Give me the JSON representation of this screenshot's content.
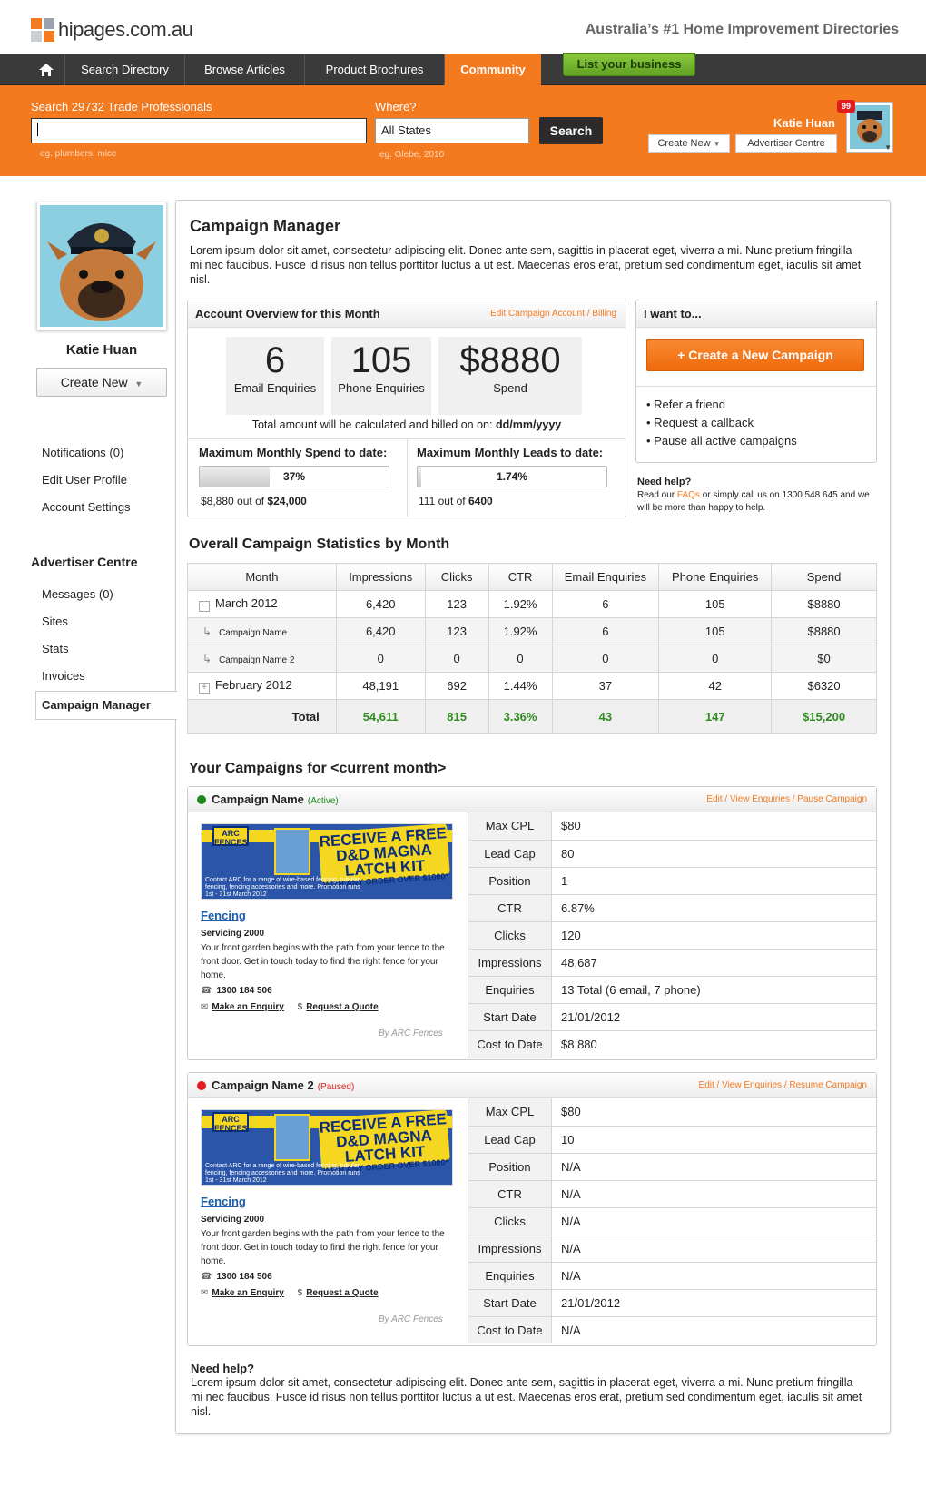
{
  "brand": {
    "logo_text": "hipages.com.au",
    "tagline": "Australia’s #1 Home Improvement Directories",
    "accent": "#f47a20",
    "logo_colors": [
      "#f47a20",
      "#9aa3ad",
      "#c9ced3",
      "#f47a20"
    ]
  },
  "nav": {
    "home_icon": "home-icon",
    "items": [
      "Search Directory",
      "Browse Articles",
      "Product Brochures",
      "Community"
    ],
    "active": "Community",
    "list_business": "List your business"
  },
  "search": {
    "label": "Search 29732 Trade Professionals",
    "value": "",
    "hint": "eg. plumbers, mice",
    "where_label": "Where?",
    "where_value": "All States",
    "where_hint": "eg. Glebe, 2010",
    "button": "Search"
  },
  "user": {
    "name": "Katie Huan",
    "create_new": "Create New",
    "advertiser_centre": "Advertiser Centre",
    "notification_count": "99"
  },
  "sidebar": {
    "name": "Katie Huan",
    "create_new": "Create New",
    "links": [
      "Notifications (0)",
      "Edit User Profile",
      "Account Settings"
    ],
    "advertiser_title": "Advertiser Centre",
    "advertiser_links": [
      "Messages (0)",
      "Sites",
      "Stats",
      "Invoices"
    ],
    "active_link": "Campaign Manager"
  },
  "main": {
    "title": "Campaign Manager",
    "description": "Lorem ipsum dolor sit amet, consectetur adipiscing elit. Donec ante sem, sagittis in placerat eget, viverra a mi. Nunc pretium fringilla mi nec faucibus. Fusce id risus non tellus porttitor luctus a ut est. Maecenas eros erat, pretium sed condimentum eget, iaculis sit amet nisl."
  },
  "overview": {
    "title": "Account Overview for this Month",
    "edit_link": "Edit Campaign Account / Billing",
    "stats": [
      {
        "value": "6",
        "label": "Email Enquiries"
      },
      {
        "value": "105",
        "label": "Phone Enquiries"
      },
      {
        "value": "$8880",
        "label": "Spend"
      }
    ],
    "billing_prefix": "Total amount will be calculated and billed on on:",
    "billing_date": "dd/mm/yyyy",
    "spend": {
      "title": "Maximum Monthly Spend to date:",
      "percent_label": "37%",
      "fraction": 0.37,
      "current": "$8,880",
      "out_of": "out of",
      "max": "$24,000"
    },
    "leads": {
      "title": "Maximum Monthly Leads to date:",
      "percent_label": "1.74%",
      "fraction": 0.0174,
      "current": "111",
      "out_of": "out of",
      "max": "6400"
    }
  },
  "iwant": {
    "title": "I want to...",
    "button": "+ Create a New Campaign",
    "items": [
      "• Refer a friend",
      "• Request a callback",
      "• Pause all active campaigns"
    ],
    "help_title": "Need help?",
    "help_pre": "Read our",
    "help_link": "FAQs",
    "help_post": "or simply call us on 1300 548 645 and we will be more than happy to help."
  },
  "stats": {
    "title": "Overall Campaign Statistics by Month",
    "headers": [
      "Month",
      "Impressions",
      "Clicks",
      "CTR",
      "Email Enquiries",
      "Phone Enquiries",
      "Spend"
    ],
    "rows": [
      {
        "type": "month",
        "toggle": "−",
        "cells": [
          "March 2012",
          "6,420",
          "123",
          "1.92%",
          "6",
          "105",
          "$8880"
        ]
      },
      {
        "type": "sub",
        "cells": [
          "Campaign Name",
          "6,420",
          "123",
          "1.92%",
          "6",
          "105",
          "$8880"
        ]
      },
      {
        "type": "sub",
        "cells": [
          "Campaign Name 2",
          "0",
          "0",
          "0",
          "0",
          "0",
          "$0"
        ]
      },
      {
        "type": "month",
        "toggle": "+",
        "cells": [
          "February 2012",
          "48,191",
          "692",
          "1.44%",
          "37",
          "42",
          "$6320"
        ]
      }
    ],
    "total": [
      "Total",
      "54,611",
      "815",
      "3.36%",
      "43",
      "147",
      "$15,200"
    ]
  },
  "campaigns_title": "Your Campaigns for <current month>",
  "campaigns": [
    {
      "name": "Campaign Name",
      "status": "(Active)",
      "status_color": "#1a8a1a",
      "actions": "Edit / View Enquiries / Pause Campaign",
      "ad": {
        "logo": "ARC FENCES",
        "headline": "RECEIVE A FREE D&D MAGNA LATCH KIT",
        "headline_sub": "WITH ANY ORDER OVER $1000*",
        "fine": "Contact ARC for a range of wire-based fencing, tubular fencing, fencing accessories and more. Promotion runs 1st - 31st March 2012",
        "title": "Fencing",
        "servicing": "Servicing 2000",
        "desc": "Your front garden begins with the path from your fence to the front door. Get in touch today to find the right fence for your home.",
        "phone": "1300 184 506",
        "enquiry": "Make an Enquiry",
        "quote": "Request a Quote",
        "by": "By ARC Fences"
      },
      "details": [
        [
          "Max CPL",
          "$80"
        ],
        [
          "Lead Cap",
          "80"
        ],
        [
          "Position",
          "1"
        ],
        [
          "CTR",
          "6.87%"
        ],
        [
          "Clicks",
          "120"
        ],
        [
          "Impressions",
          "48,687"
        ],
        [
          "Enquiries",
          "13 Total (6 email, 7 phone)"
        ],
        [
          "Start Date",
          "21/01/2012"
        ],
        [
          "Cost to Date",
          "$8,880"
        ]
      ]
    },
    {
      "name": "Campaign Name 2",
      "status": "(Paused)",
      "status_color": "#e01c1c",
      "actions": "Edit / View Enquiries / Resume Campaign",
      "ad": {
        "logo": "ARC FENCES",
        "headline": "RECEIVE A FREE D&D MAGNA LATCH KIT",
        "headline_sub": "WITH ANY ORDER OVER $1000*",
        "fine": "Contact ARC for a range of wire-based fencing, tubular fencing, fencing accessories and more. Promotion runs 1st - 31st March 2012",
        "title": "Fencing",
        "servicing": "Servicing 2000",
        "desc": "Your front garden begins with the path from your fence to the front door. Get in touch today to find the right fence for your home.",
        "phone": "1300 184 506",
        "enquiry": "Make an Enquiry",
        "quote": "Request a Quote",
        "by": "By ARC Fences"
      },
      "details": [
        [
          "Max CPL",
          "$80"
        ],
        [
          "Lead Cap",
          "10"
        ],
        [
          "Position",
          "N/A"
        ],
        [
          "CTR",
          "N/A"
        ],
        [
          "Clicks",
          "N/A"
        ],
        [
          "Impressions",
          "N/A"
        ],
        [
          "Enquiries",
          "N/A"
        ],
        [
          "Start Date",
          "21/01/2012"
        ],
        [
          "Cost to Date",
          "N/A"
        ]
      ]
    }
  ],
  "footer_help": {
    "title": "Need help?",
    "desc": "Lorem ipsum dolor sit amet, consectetur adipiscing elit. Donec ante sem, sagittis in placerat eget, viverra a mi. Nunc pretium fringilla mi nec faucibus. Fusce id risus non tellus porttitor luctus a ut est. Maecenas eros erat, pretium sed condimentum eget, iaculis sit amet nisl."
  }
}
